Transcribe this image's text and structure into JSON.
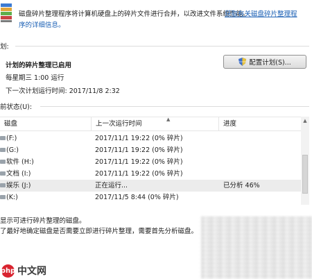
{
  "header": {
    "description_line1": "磁盘碎片整理程序将计算机硬盘上的碎片文件进行合并，以改进文件系统性能。",
    "description_line2": "序的详细信息。",
    "help_link": "获取有关磁盘碎片整理程"
  },
  "schedule": {
    "heading": "划:",
    "status": "计划的碎片整理已启用",
    "frequency": "每星期三  1:00 运行",
    "next_run": "下一次计划运行时间: 2017/11/8 2:32",
    "configure_button": "配置计划(S)..."
  },
  "current_status": {
    "heading": "前状态(U):",
    "columns": [
      "磁盘",
      "上一次运行时间",
      "进度"
    ],
    "rows": [
      {
        "name": "(F:)",
        "last_run": "2017/11/1 19:22 (0% 碎片)",
        "progress": ""
      },
      {
        "name": "(G:)",
        "last_run": "2017/11/1 19:22 (0% 碎片)",
        "progress": ""
      },
      {
        "name": "软件 (H:)",
        "last_run": "2017/11/1 19:22 (0% 碎片)",
        "progress": ""
      },
      {
        "name": "文档 (I:)",
        "last_run": "2017/11/1 19:22 (0% 碎片)",
        "progress": ""
      },
      {
        "name": "娱乐 (J:)",
        "last_run": "正在运行...",
        "progress": "已分析 46%"
      },
      {
        "name": "(K:)",
        "last_run": "2017/11/5 8:44 (0% 碎片)",
        "progress": ""
      }
    ]
  },
  "footer": {
    "hint1": "显示可进行碎片整理的磁盘。",
    "hint2": "了最好地确定磁盘是否需要立即进行碎片整理，需要首先分析磁盘。"
  },
  "watermark": {
    "logo": "php",
    "text": "中文网"
  },
  "colors": {
    "link": "#1a5fb4",
    "selected_row": "#ececec",
    "watermark_red": "#d9232f"
  }
}
